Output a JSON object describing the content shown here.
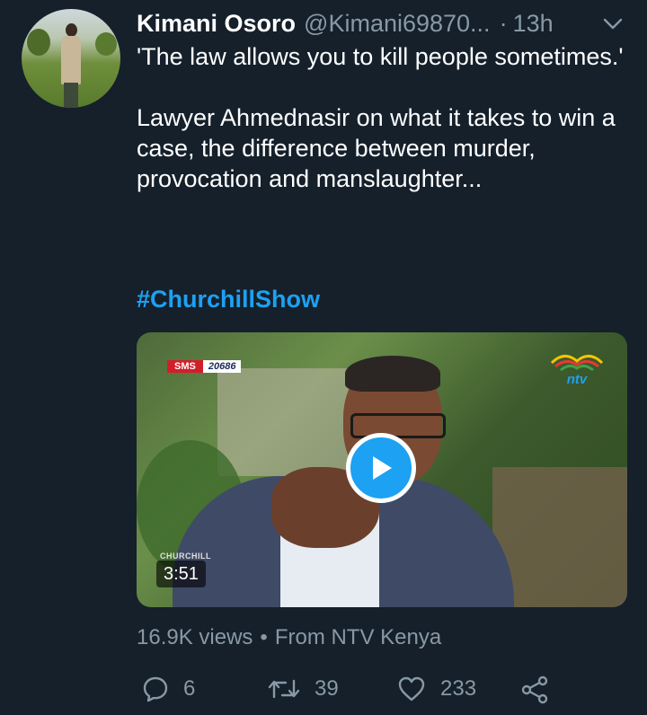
{
  "tweet": {
    "author_name": "Kimani Osoro",
    "author_handle": "@Kimani69870...",
    "separator": "·",
    "time": "13h",
    "text_line1": "'The law allows you to kill people sometimes.'",
    "text_line2": "Lawyer Ahmednasir on what it takes to win a case, the difference between murder, provocation and manslaughter...",
    "hashtag": "#ChurchillShow"
  },
  "media": {
    "sms_label": "SMS",
    "sms_number": "20686",
    "watermark": "CHURCHILL",
    "duration": "3:51"
  },
  "meta": {
    "views": "16.9K views",
    "bullet": "•",
    "source": "From NTV Kenya"
  },
  "actions": {
    "reply_count": "6",
    "retweet_count": "39",
    "like_count": "233"
  },
  "colors": {
    "background": "#15202b",
    "accent": "#1da1f2",
    "muted": "#8899a6"
  },
  "icons": [
    "avatar",
    "chevron-down-icon",
    "ntv-logo",
    "play-icon",
    "reply-icon",
    "retweet-icon",
    "like-icon",
    "share-icon"
  ]
}
